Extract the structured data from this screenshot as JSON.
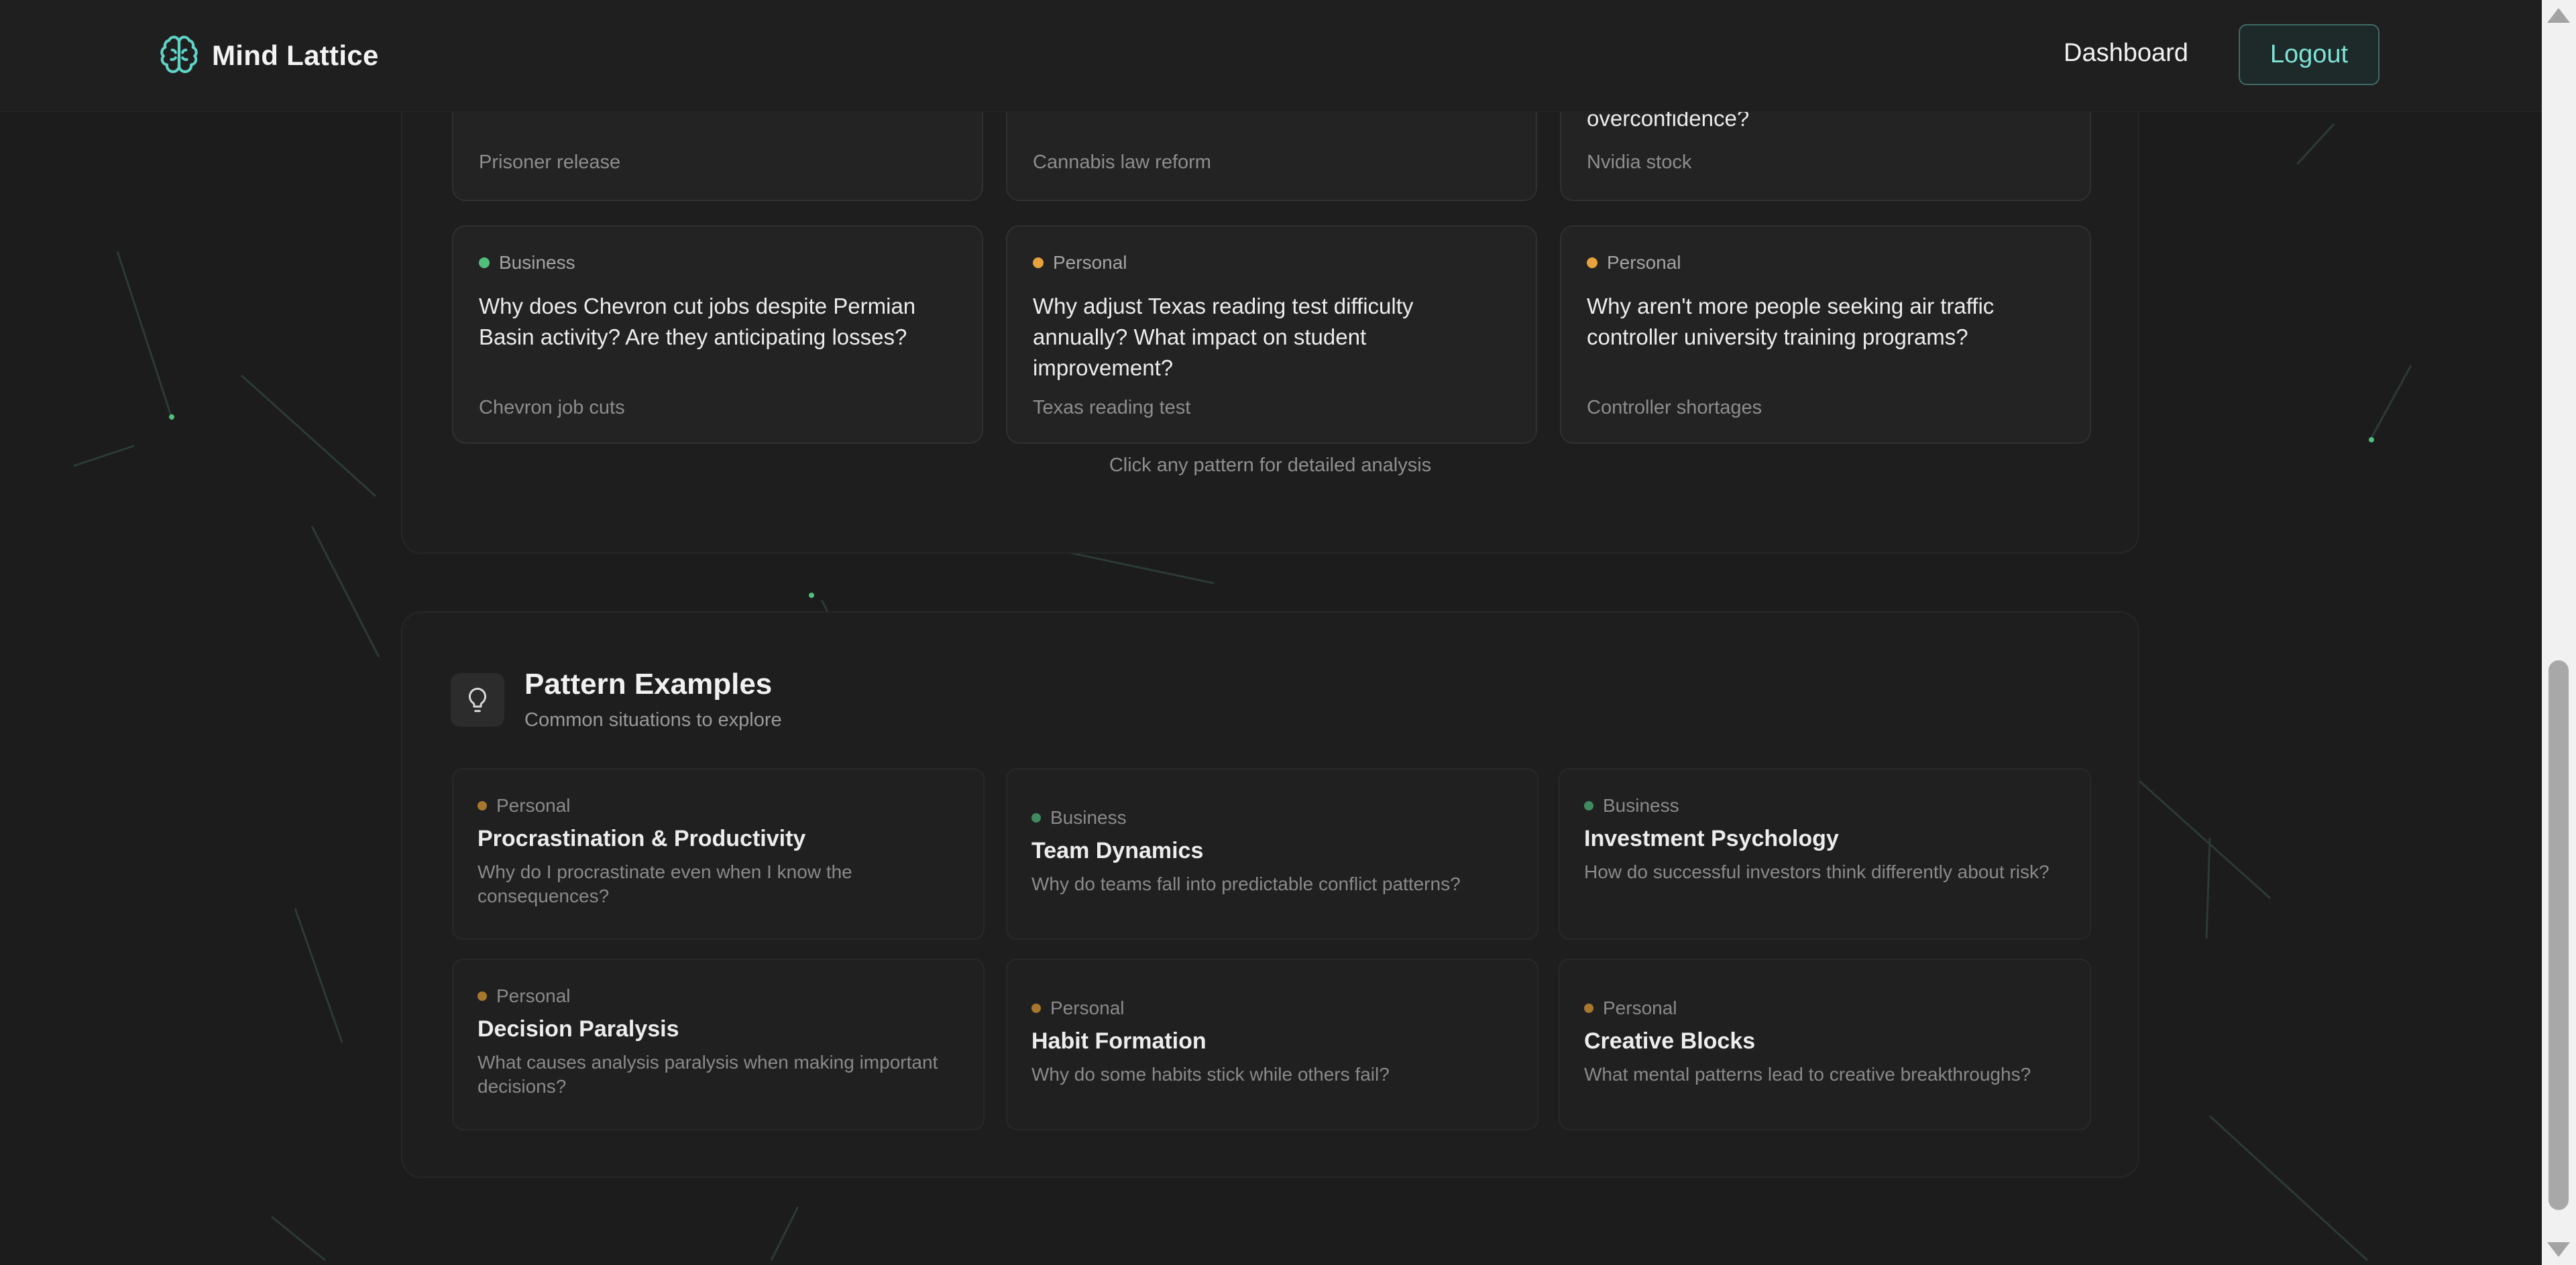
{
  "app": {
    "title": "Mind Lattice",
    "nav": {
      "dashboard": "Dashboard",
      "logout": "Logout"
    }
  },
  "colors": {
    "accent": "#5fd3c6",
    "business": "#4fbf7b",
    "personal": "#e6a23c",
    "background": "#1c1c1c"
  },
  "patterns": {
    "partial_row": [
      {
        "question": "",
        "topic": "Prisoner release"
      },
      {
        "question": "",
        "topic": "Cannabis law reform"
      },
      {
        "question": "overconfidence?",
        "topic": "Nvidia stock"
      }
    ],
    "cards": [
      {
        "category": "Business",
        "question": "Why does Chevron cut jobs despite Permian Basin activity? Are they anticipating losses?",
        "topic": "Chevron job cuts"
      },
      {
        "category": "Personal",
        "question": "Why adjust Texas reading test difficulty annually? What impact on student improvement?",
        "topic": "Texas reading test"
      },
      {
        "category": "Personal",
        "question": "Why aren't more people seeking air traffic controller university training programs?",
        "topic": "Controller shortages"
      }
    ],
    "hint": "Click any pattern for detailed analysis"
  },
  "examples": {
    "icon": "lightbulb-icon",
    "title": "Pattern Examples",
    "subtitle": "Common situations to explore",
    "items": [
      {
        "category": "Personal",
        "title": "Procrastination & Productivity",
        "desc": "Why do I procrastinate even when I know the consequences?"
      },
      {
        "category": "Business",
        "title": "Team Dynamics",
        "desc": "Why do teams fall into predictable conflict patterns?"
      },
      {
        "category": "Business",
        "title": "Investment Psychology",
        "desc": "How do successful investors think differently about risk?"
      },
      {
        "category": "Personal",
        "title": "Decision Paralysis",
        "desc": "What causes analysis paralysis when making important decisions?"
      },
      {
        "category": "Personal",
        "title": "Habit Formation",
        "desc": "Why do some habits stick while others fail?"
      },
      {
        "category": "Personal",
        "title": "Creative Blocks",
        "desc": "What mental patterns lead to creative breakthroughs?"
      }
    ]
  }
}
